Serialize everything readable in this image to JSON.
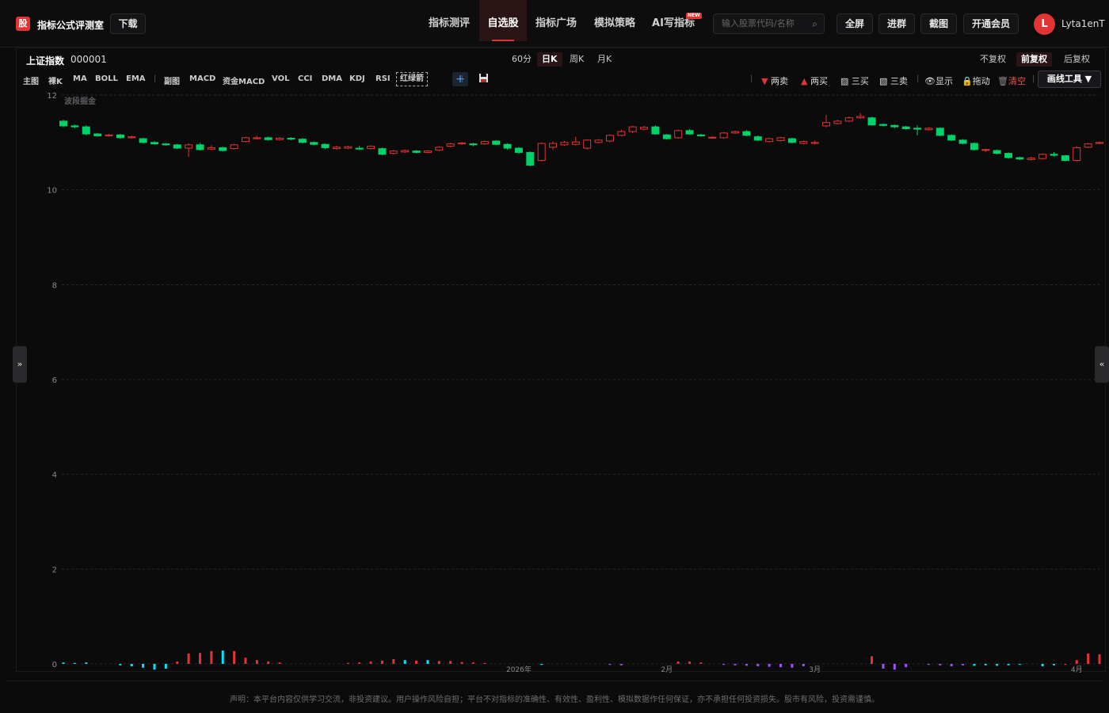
{
  "header": {
    "logo_char": "股",
    "brand": "指标公式评测室",
    "download": "下载",
    "nav": [
      {
        "label": "指标测评",
        "active": false
      },
      {
        "label": "自选股",
        "active": true
      },
      {
        "label": "指标广场",
        "active": false
      },
      {
        "label": "模拟策略",
        "active": false
      },
      {
        "label": "AI写指标",
        "active": false
      }
    ],
    "new_tag": "NEW",
    "search_placeholder": "输入股票代码/名称",
    "buttons": [
      "全屏",
      "进群",
      "截图",
      "开通会员"
    ],
    "avatar_letter": "L",
    "username": "Lyta1enT"
  },
  "symbol": {
    "name": "上证指数",
    "code": "000001"
  },
  "periods": [
    {
      "label": "60分",
      "active": false
    },
    {
      "label": "日K",
      "active": true
    },
    {
      "label": "周K",
      "active": false
    },
    {
      "label": "月K",
      "active": false
    }
  ],
  "adjust": [
    {
      "label": "不复权",
      "active": false
    },
    {
      "label": "前复权",
      "active": true
    },
    {
      "label": "后复权",
      "active": false
    }
  ],
  "indicators_main": [
    "主图",
    "裸K",
    "MA",
    "BOLL",
    "EMA"
  ],
  "indicators_sub": [
    "副图",
    "MACD",
    "资金MACD",
    "VOL",
    "CCI",
    "DMA",
    "KDJ",
    "RSI",
    "红绿箭"
  ],
  "tools": [
    {
      "icon": "triangle-down-icon",
      "label": "两卖",
      "color": "#e23434"
    },
    {
      "icon": "triangle-up-icon",
      "label": "两买",
      "color": "#e23434"
    },
    {
      "icon": "pencil-icon",
      "label": "三买",
      "color": "#ddd"
    },
    {
      "icon": "pencil-icon",
      "label": "三卖",
      "color": "#ddd"
    },
    {
      "icon": "eye-icon",
      "label": "显示",
      "color": "#ddd"
    },
    {
      "icon": "lock-icon",
      "label": "拖动",
      "color": "#ddd"
    },
    {
      "icon": "trash-icon",
      "label": "清空",
      "color": "#ff4b4b"
    }
  ],
  "draw_tool": "画线工具 ▼",
  "side_left": "»",
  "side_right": "«",
  "disclaimer": "声明：本平台内容仅供学习交流，非投资建议。用户操作风险自担；平台不对指标的准确性、有效性、盈利性、模拟数据作任何保证，亦不承担任何投资损失。股市有风险，投资需谨慎。",
  "colors": {
    "up": "#e23434",
    "down": "#00d26a",
    "grid": "#2a2a2c",
    "accent": "#e23434"
  },
  "chart_data": {
    "type": "candlestick",
    "watermark": "波段掘金",
    "ylim": [
      0,
      12
    ],
    "yticks": [
      0,
      2,
      4,
      6,
      8,
      10,
      12
    ],
    "xlabels": [
      {
        "index": 40,
        "label": "2026年"
      },
      {
        "index": 53,
        "label": "2月"
      },
      {
        "index": 66,
        "label": "3月"
      },
      {
        "index": 89,
        "label": "4月"
      }
    ],
    "candles": [
      [
        11.45,
        11.35,
        11.48,
        11.32
      ],
      [
        11.35,
        11.33,
        11.38,
        11.3
      ],
      [
        11.33,
        11.18,
        11.36,
        11.15
      ],
      [
        11.18,
        11.14,
        11.2,
        11.12
      ],
      [
        11.14,
        11.16,
        11.18,
        11.12
      ],
      [
        11.16,
        11.1,
        11.18,
        11.08
      ],
      [
        11.1,
        11.12,
        11.14,
        11.08
      ],
      [
        11.08,
        11.0,
        11.1,
        10.98
      ],
      [
        11.0,
        10.97,
        11.03,
        10.95
      ],
      [
        10.97,
        10.95,
        10.99,
        10.93
      ],
      [
        10.95,
        10.88,
        10.97,
        10.86
      ],
      [
        10.88,
        10.95,
        10.98,
        10.7
      ],
      [
        10.95,
        10.85,
        10.99,
        10.83
      ],
      [
        10.86,
        10.89,
        10.94,
        10.84
      ],
      [
        10.89,
        10.83,
        10.91,
        10.81
      ],
      [
        10.87,
        10.95,
        10.97,
        10.85
      ],
      [
        11.02,
        11.1,
        11.12,
        11.0
      ],
      [
        11.08,
        11.1,
        11.14,
        11.06
      ],
      [
        11.1,
        11.06,
        11.12,
        11.04
      ],
      [
        11.06,
        11.09,
        11.11,
        11.04
      ],
      [
        11.09,
        11.07,
        11.11,
        11.05
      ],
      [
        11.07,
        11.0,
        11.09,
        10.98
      ],
      [
        11.0,
        10.96,
        11.02,
        10.94
      ],
      [
        10.96,
        10.89,
        10.98,
        10.86
      ],
      [
        10.87,
        10.9,
        10.93,
        10.85
      ],
      [
        10.88,
        10.91,
        10.93,
        10.86
      ],
      [
        10.88,
        10.86,
        10.93,
        10.84
      ],
      [
        10.87,
        10.92,
        10.94,
        10.85
      ],
      [
        10.87,
        10.75,
        10.89,
        10.73
      ],
      [
        10.77,
        10.82,
        10.84,
        10.75
      ],
      [
        10.8,
        10.83,
        10.85,
        10.78
      ],
      [
        10.82,
        10.79,
        10.84,
        10.77
      ],
      [
        10.79,
        10.82,
        10.84,
        10.77
      ],
      [
        10.84,
        10.9,
        10.92,
        10.82
      ],
      [
        10.92,
        10.97,
        10.99,
        10.9
      ],
      [
        10.97,
        10.99,
        11.01,
        10.95
      ],
      [
        10.97,
        10.95,
        10.99,
        10.92
      ],
      [
        10.97,
        11.02,
        11.04,
        10.95
      ],
      [
        11.03,
        10.96,
        11.05,
        10.94
      ],
      [
        10.96,
        10.88,
        10.98,
        10.85
      ],
      [
        10.88,
        10.79,
        10.9,
        10.76
      ],
      [
        10.79,
        10.52,
        10.81,
        10.5
      ],
      [
        10.62,
        10.98,
        11.0,
        10.6
      ],
      [
        10.9,
        10.98,
        11.02,
        10.85
      ],
      [
        10.95,
        11.0,
        11.03,
        10.93
      ],
      [
        10.96,
        11.01,
        11.12,
        10.94
      ],
      [
        10.88,
        11.05,
        11.07,
        10.85
      ],
      [
        11.0,
        11.05,
        11.07,
        10.98
      ],
      [
        11.03,
        11.15,
        11.17,
        11.0
      ],
      [
        11.15,
        11.23,
        11.27,
        11.13
      ],
      [
        11.23,
        11.33,
        11.35,
        11.2
      ],
      [
        11.28,
        11.32,
        11.35,
        11.26
      ],
      [
        11.33,
        11.18,
        11.36,
        11.16
      ],
      [
        11.16,
        11.08,
        11.18,
        11.06
      ],
      [
        11.1,
        11.25,
        11.27,
        11.08
      ],
      [
        11.25,
        11.18,
        11.28,
        11.16
      ],
      [
        11.16,
        11.14,
        11.18,
        11.12
      ],
      [
        11.11,
        11.11,
        11.13,
        11.09
      ],
      [
        11.1,
        11.2,
        11.22,
        11.08
      ],
      [
        11.2,
        11.23,
        11.25,
        11.18
      ],
      [
        11.23,
        11.15,
        11.26,
        11.13
      ],
      [
        11.12,
        11.05,
        11.15,
        11.03
      ],
      [
        11.02,
        11.08,
        11.1,
        11.0
      ],
      [
        11.04,
        11.1,
        11.12,
        11.02
      ],
      [
        11.08,
        11.0,
        11.1,
        10.98
      ],
      [
        10.98,
        11.02,
        11.04,
        10.96
      ],
      [
        10.98,
        11.0,
        11.04,
        10.96
      ],
      [
        11.35,
        11.42,
        11.58,
        11.32
      ],
      [
        11.4,
        11.45,
        11.48,
        11.38
      ],
      [
        11.45,
        11.52,
        11.55,
        11.43
      ],
      [
        11.52,
        11.55,
        11.62,
        11.5
      ],
      [
        11.52,
        11.37,
        11.54,
        11.35
      ],
      [
        11.38,
        11.36,
        11.4,
        11.34
      ],
      [
        11.36,
        11.33,
        11.38,
        11.3
      ],
      [
        11.33,
        11.29,
        11.35,
        11.27
      ],
      [
        11.3,
        11.28,
        11.36,
        11.15
      ],
      [
        11.27,
        11.3,
        11.32,
        11.25
      ],
      [
        11.3,
        11.15,
        11.32,
        11.13
      ],
      [
        11.15,
        11.05,
        11.17,
        11.03
      ],
      [
        11.05,
        10.98,
        11.07,
        10.96
      ],
      [
        10.98,
        10.85,
        11.0,
        10.83
      ],
      [
        10.85,
        10.85,
        10.87,
        10.8
      ],
      [
        10.83,
        10.77,
        10.85,
        10.75
      ],
      [
        10.77,
        10.68,
        10.79,
        10.66
      ],
      [
        10.68,
        10.65,
        10.7,
        10.63
      ],
      [
        10.64,
        10.67,
        10.7,
        10.62
      ],
      [
        10.66,
        10.75,
        10.77,
        10.64
      ],
      [
        10.75,
        10.73,
        10.8,
        10.7
      ],
      [
        10.72,
        10.62,
        10.74,
        10.6
      ],
      [
        10.62,
        10.89,
        10.92,
        10.6
      ],
      [
        10.9,
        10.97,
        10.99,
        10.88
      ],
      [
        10.98,
        11.0,
        11.02,
        10.96
      ]
    ],
    "indicator_bars": [
      [
        0,
        0.03,
        "#00e5ff"
      ],
      [
        1,
        0.02,
        "#00e5ff"
      ],
      [
        2,
        0.03,
        "#00e5ff"
      ],
      [
        5,
        -0.03,
        "#00e5ff"
      ],
      [
        6,
        -0.05,
        "#00e5ff"
      ],
      [
        7,
        -0.08,
        "#00e5ff"
      ],
      [
        8,
        -0.12,
        "#00e5ff"
      ],
      [
        9,
        -0.1,
        "#00e5ff"
      ],
      [
        10,
        0.05,
        "#e23434"
      ],
      [
        11,
        0.22,
        "#e23434"
      ],
      [
        12,
        0.23,
        "#e23434"
      ],
      [
        13,
        0.27,
        "#e23434"
      ],
      [
        14,
        0.28,
        "#00e5ff"
      ],
      [
        15,
        0.27,
        "#e23434"
      ],
      [
        16,
        0.13,
        "#e23434"
      ],
      [
        17,
        0.08,
        "#e23434"
      ],
      [
        18,
        0.05,
        "#e23434"
      ],
      [
        19,
        0.03,
        "#e23434"
      ],
      [
        25,
        0.02,
        "#e23434"
      ],
      [
        26,
        0.03,
        "#e23434"
      ],
      [
        27,
        0.05,
        "#e23434"
      ],
      [
        28,
        0.07,
        "#e23434"
      ],
      [
        29,
        0.1,
        "#e23434"
      ],
      [
        30,
        0.08,
        "#00e5ff"
      ],
      [
        31,
        0.07,
        "#e23434"
      ],
      [
        32,
        0.08,
        "#00e5ff"
      ],
      [
        33,
        0.06,
        "#e23434"
      ],
      [
        34,
        0.06,
        "#e23434"
      ],
      [
        35,
        0.04,
        "#e23434"
      ],
      [
        36,
        0.03,
        "#e23434"
      ],
      [
        37,
        0.02,
        "#e23434"
      ],
      [
        42,
        -0.02,
        "#00e5ff"
      ],
      [
        48,
        -0.02,
        "#a050ff"
      ],
      [
        49,
        -0.03,
        "#a050ff"
      ],
      [
        54,
        0.05,
        "#e23434"
      ],
      [
        55,
        0.05,
        "#e23434"
      ],
      [
        56,
        0.03,
        "#e23434"
      ],
      [
        58,
        -0.02,
        "#a050ff"
      ],
      [
        59,
        -0.03,
        "#a050ff"
      ],
      [
        60,
        -0.04,
        "#a050ff"
      ],
      [
        61,
        -0.05,
        "#a050ff"
      ],
      [
        62,
        -0.06,
        "#a050ff"
      ],
      [
        63,
        -0.07,
        "#a050ff"
      ],
      [
        64,
        -0.08,
        "#a050ff"
      ],
      [
        65,
        -0.05,
        "#a050ff"
      ],
      [
        71,
        0.16,
        "#e23434"
      ],
      [
        72,
        -0.1,
        "#a050ff"
      ],
      [
        73,
        -0.12,
        "#a050ff"
      ],
      [
        74,
        -0.07,
        "#a050ff"
      ],
      [
        76,
        -0.02,
        "#a050ff"
      ],
      [
        77,
        -0.03,
        "#a050ff"
      ],
      [
        78,
        -0.05,
        "#a050ff"
      ],
      [
        79,
        -0.03,
        "#a050ff"
      ],
      [
        80,
        -0.04,
        "#00e5ff"
      ],
      [
        81,
        -0.03,
        "#00e5ff"
      ],
      [
        82,
        -0.04,
        "#00e5ff"
      ],
      [
        83,
        -0.03,
        "#00e5ff"
      ],
      [
        84,
        -0.02,
        "#00e5ff"
      ],
      [
        86,
        -0.05,
        "#00e5ff"
      ],
      [
        87,
        -0.03,
        "#00e5ff"
      ],
      [
        88,
        -0.02,
        "#e23434"
      ],
      [
        89,
        0.08,
        "#e23434"
      ],
      [
        90,
        0.22,
        "#e23434"
      ],
      [
        91,
        0.2,
        "#e23434"
      ],
      [
        92,
        0.18,
        "#e23434"
      ]
    ]
  }
}
